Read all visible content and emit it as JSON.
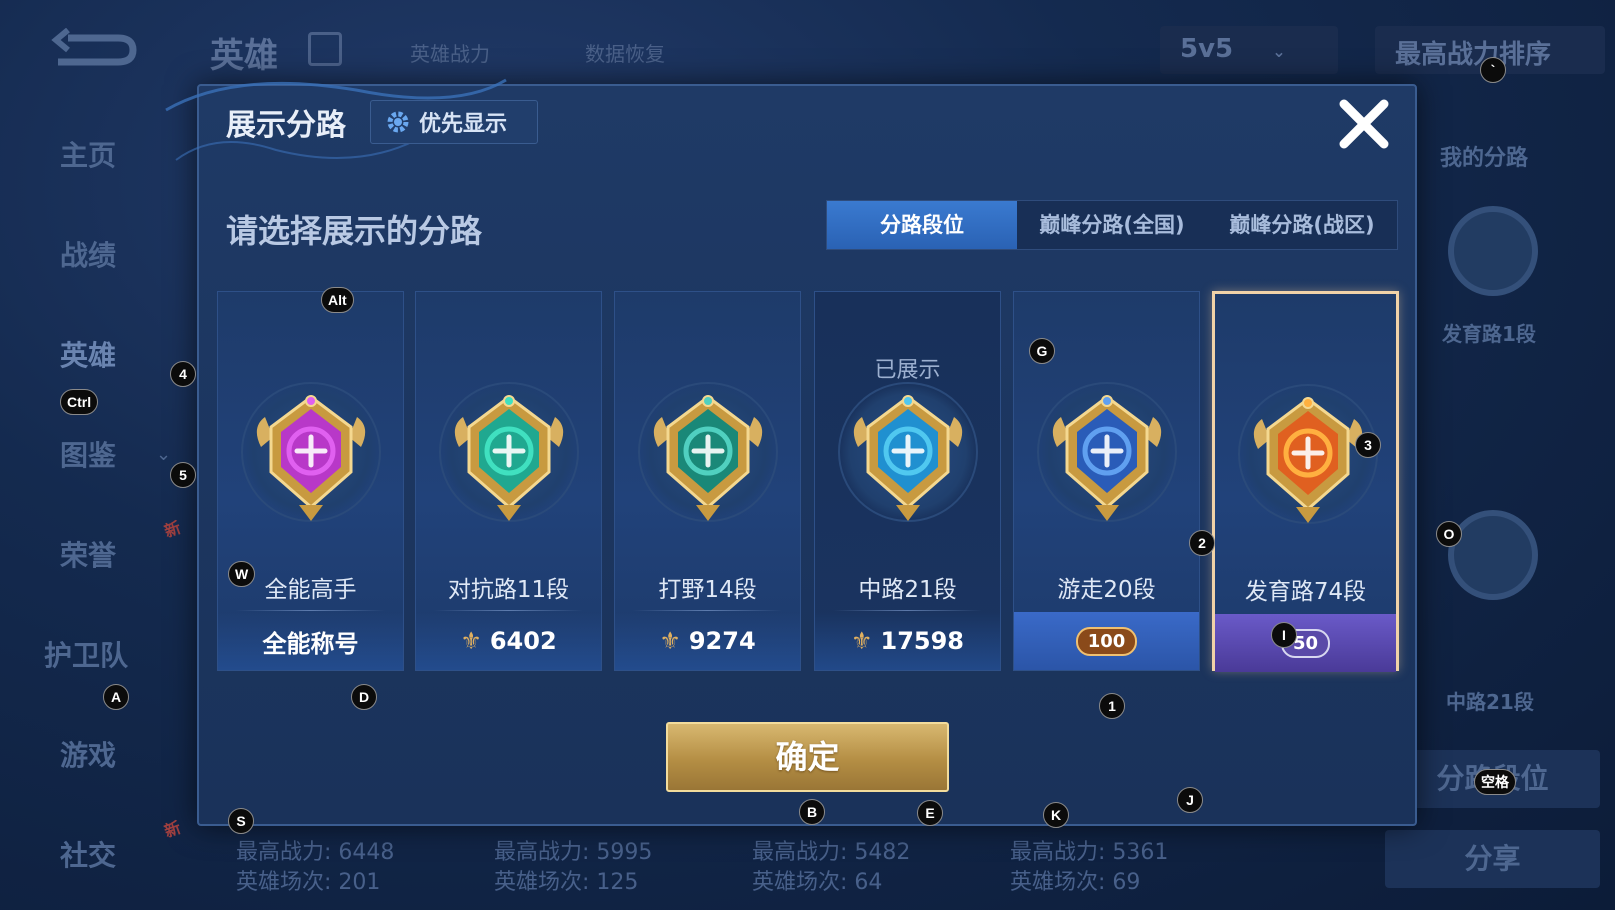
{
  "background": {
    "title": "英雄",
    "links": [
      "英雄战力",
      "数据恢复"
    ],
    "mode_dropdown": "5v5",
    "sort_dropdown": "最高战力排序",
    "sidebar": [
      "主页",
      "战绩",
      "英雄",
      "图鉴",
      "荣誉",
      "护卫队",
      "游戏",
      "社交"
    ],
    "new_badge": "新",
    "right_panel": {
      "header": "我的分路",
      "lane1": "发育路1段",
      "lane2": "中路21段",
      "badge_level": "50",
      "tab_button": "分路段位",
      "share_button": "分享"
    },
    "stats": [
      {
        "power": "最高战力: 6448",
        "games": "英雄场次: 201"
      },
      {
        "power": "最高战力: 5995",
        "games": "英雄场次: 125"
      },
      {
        "power": "最高战力: 5482",
        "games": "英雄场次: 64"
      },
      {
        "power": "最高战力: 5361",
        "games": "英雄场次: 69"
      }
    ]
  },
  "dialog": {
    "title": "展示分路",
    "priority_button": "优先显示",
    "subtitle": "请选择展示的分路",
    "tabs": [
      "分路段位",
      "巅峰分路(全国)",
      "巅峰分路(战区)"
    ],
    "active_tab": 0,
    "cards": [
      {
        "name": "全能高手",
        "footer": "全能称号",
        "medal_color": "#b838c8",
        "accent": "#e060f0"
      },
      {
        "name": "对抗路11段",
        "footer": "6402",
        "medal_color": "#20a890",
        "accent": "#40e0c0"
      },
      {
        "name": "打野14段",
        "footer": "9274",
        "medal_color": "#1a8878",
        "accent": "#50d0c0"
      },
      {
        "name": "中路21段",
        "footer": "17598",
        "shown_label": "已展示",
        "medal_color": "#2090d0",
        "accent": "#50c8f0"
      },
      {
        "name": "游走20段",
        "badge": "100",
        "medal_color": "#2a5cb8",
        "accent": "#60a0f0"
      },
      {
        "name": "发育路74段",
        "badge": "50",
        "medal_color": "#e06020",
        "accent": "#ffb040",
        "selected": true
      }
    ],
    "confirm_button": "确定"
  },
  "key_hints": [
    "`",
    "Alt",
    "4",
    "Ctrl",
    "5",
    "W",
    "A",
    "D",
    "S",
    "G",
    "3",
    "2",
    "O",
    "I",
    "1",
    "B",
    "E",
    "K",
    "J",
    "空格"
  ]
}
